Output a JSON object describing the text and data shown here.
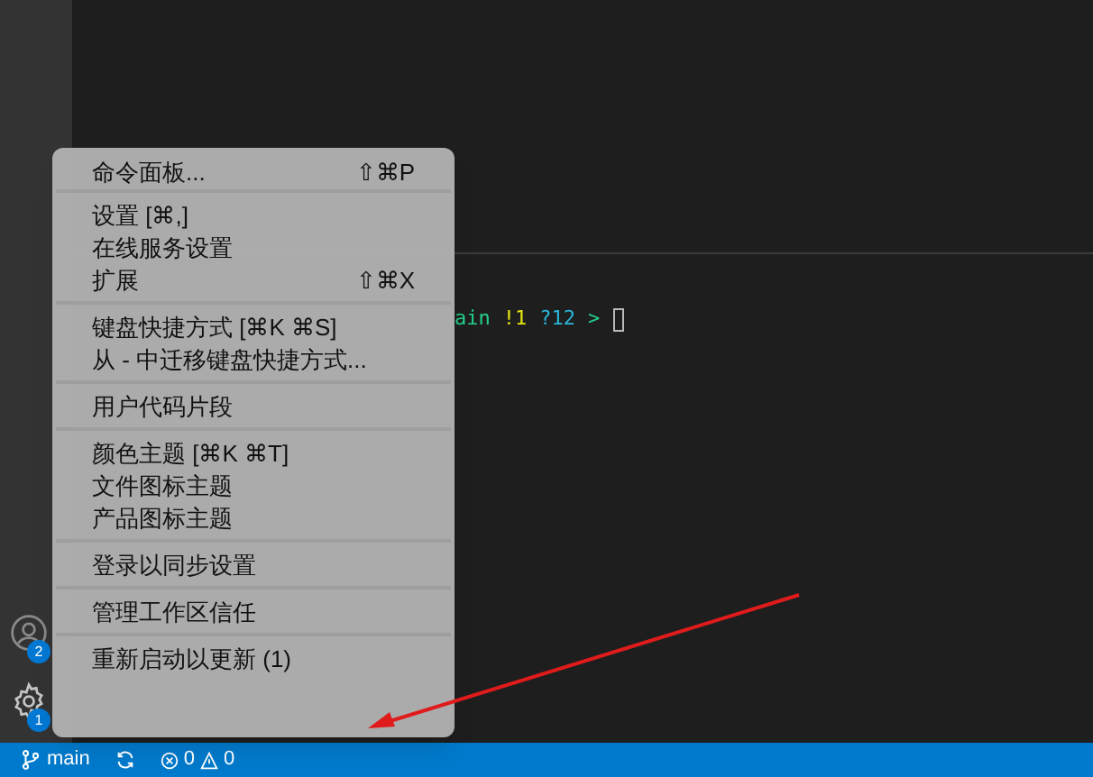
{
  "activity_bar": {
    "badges": [
      {
        "kind": "account",
        "count": "2"
      },
      {
        "kind": "manage",
        "count": "1"
      }
    ]
  },
  "terminal": {
    "line": [
      {
        "text": "ain",
        "color": "#23d18b"
      },
      {
        "text": "!1",
        "color": "#e5e510"
      },
      {
        "text": "?12",
        "color": "#29b8db"
      },
      {
        "text": ">",
        "color": "#23d18b"
      }
    ]
  },
  "menu": {
    "groups": [
      [
        {
          "label": "命令面板...",
          "shortcut": "⇧⌘P"
        }
      ],
      [
        {
          "label": "设置 [⌘,]"
        },
        {
          "label": "在线服务设置"
        },
        {
          "label": "扩展",
          "shortcut": "⇧⌘X"
        }
      ],
      [
        {
          "label": "键盘快捷方式 [⌘K ⌘S]"
        },
        {
          "label": "从 - 中迁移键盘快捷方式..."
        }
      ],
      [
        {
          "label": "用户代码片段"
        }
      ],
      [
        {
          "label": "颜色主题 [⌘K ⌘T]"
        },
        {
          "label": "文件图标主题"
        },
        {
          "label": "产品图标主题"
        }
      ],
      [
        {
          "label": "登录以同步设置"
        }
      ],
      [
        {
          "label": "管理工作区信任"
        }
      ],
      [
        {
          "label": "重新启动以更新 (1)"
        }
      ]
    ]
  },
  "status_bar": {
    "branch": "main",
    "errors": "0",
    "warnings": "0"
  }
}
